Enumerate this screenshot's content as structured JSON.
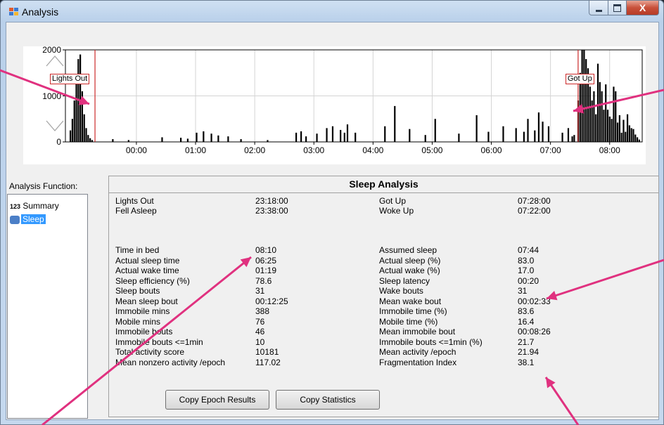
{
  "window": {
    "title": "Analysis",
    "icon": "app-window-icon"
  },
  "titlebar_controls": {
    "minimize": "minimize-icon",
    "maximize": "maximize-icon",
    "close": "close-icon",
    "close_glyph": "X"
  },
  "chart_data": {
    "type": "bar",
    "title": "",
    "xlabel": "",
    "ylabel": "",
    "ylim": [
      0,
      2000
    ],
    "xlim": [
      "22:48",
      "08:33"
    ],
    "y_ticks": [
      "2000",
      "1000",
      "0"
    ],
    "x_ticks": [
      "00:00",
      "01:00",
      "02:00",
      "03:00",
      "04:00",
      "05:00",
      "06:00",
      "07:00",
      "08:00"
    ],
    "grid": true,
    "markers": [
      {
        "label": "Lights Out",
        "time": "23:18",
        "color": "#cc2a2a"
      },
      {
        "label": "Got Up",
        "time": "07:28",
        "color": "#cc2a2a"
      }
    ],
    "series": [
      {
        "x": [
          "22:53",
          "22:55",
          "22:57",
          "22:59",
          "23:01",
          "23:03",
          "23:05",
          "23:07",
          "23:09",
          "23:11",
          "23:13",
          "23:15",
          "23:36",
          "23:52",
          "00:26",
          "00:45",
          "00:52",
          "01:01",
          "01:08",
          "01:16",
          "01:23",
          "01:33",
          "01:46",
          "02:13",
          "02:42",
          "02:47",
          "02:52",
          "03:03",
          "03:13",
          "03:19",
          "03:27",
          "03:31",
          "03:34",
          "03:42",
          "04:12",
          "04:22",
          "04:37",
          "04:53",
          "05:03",
          "05:27",
          "05:45",
          "05:57",
          "06:12",
          "06:25",
          "06:33",
          "06:37",
          "06:44",
          "06:48",
          "06:52",
          "06:58",
          "07:12",
          "07:18",
          "07:22",
          "07:24",
          "07:28",
          "07:30",
          "07:32",
          "07:34",
          "07:36",
          "07:38",
          "07:40",
          "07:42",
          "07:44",
          "07:46",
          "07:48",
          "07:50",
          "07:52",
          "07:54",
          "07:56",
          "07:58",
          "08:00",
          "08:02",
          "08:04",
          "08:06",
          "08:08",
          "08:10",
          "08:12",
          "08:14",
          "08:16",
          "08:18",
          "08:20",
          "08:22",
          "08:24",
          "08:26",
          "08:28",
          "08:30"
        ],
        "values": [
          250,
          500,
          900,
          1400,
          1800,
          1900,
          1100,
          600,
          300,
          150,
          80,
          40,
          60,
          40,
          100,
          90,
          70,
          200,
          230,
          180,
          140,
          120,
          60,
          40,
          200,
          230,
          120,
          180,
          300,
          340,
          260,
          200,
          380,
          200,
          340,
          780,
          280,
          150,
          500,
          180,
          580,
          220,
          340,
          300,
          220,
          500,
          250,
          640,
          440,
          340,
          200,
          300,
          120,
          150,
          900,
          1500,
          2000,
          2000,
          1800,
          1600,
          1200,
          900,
          1100,
          600,
          1700,
          1300,
          1100,
          700,
          1250,
          700,
          550,
          500,
          1200,
          1100,
          420,
          580,
          200,
          480,
          220,
          600,
          360,
          300,
          280,
          160,
          100,
          50
        ]
      }
    ]
  },
  "sidebar": {
    "label": "Analysis Function:",
    "items": [
      {
        "prefix": "123",
        "label": "Summary",
        "icon": "summary-icon"
      },
      {
        "prefix": "",
        "label": "Sleep",
        "icon": "sleep-icon",
        "selected": true
      }
    ]
  },
  "results": {
    "title": "Sleep Analysis",
    "top_left": [
      {
        "label": "Lights Out",
        "value": "23:18:00"
      },
      {
        "label": "Fell Asleep",
        "value": "23:38:00"
      }
    ],
    "top_right": [
      {
        "label": "Got Up",
        "value": "07:28:00"
      },
      {
        "label": "Woke Up",
        "value": "07:22:00"
      }
    ],
    "left": [
      {
        "label": "Time in bed",
        "value": "08:10"
      },
      {
        "label": "Actual sleep time",
        "value": "06:25"
      },
      {
        "label": "Actual wake time",
        "value": "01:19"
      },
      {
        "label": "Sleep efficiency (%)",
        "value": "78.6"
      },
      {
        "label": "Sleep bouts",
        "value": "31"
      },
      {
        "label": "Mean sleep bout",
        "value": "00:12:25"
      },
      {
        "label": "Immobile mins",
        "value": "388"
      },
      {
        "label": "Mobile mins",
        "value": "76"
      },
      {
        "label": "Immobile bouts",
        "value": "46"
      },
      {
        "label": "Immobile bouts <=1min",
        "value": "10"
      },
      {
        "label": "Total activity score",
        "value": "10181"
      },
      {
        "label": "Mean nonzero activity /epoch",
        "value": "117.02"
      }
    ],
    "right": [
      {
        "label": "Assumed sleep",
        "value": "07:44"
      },
      {
        "label": "Actual sleep (%)",
        "value": "83.0"
      },
      {
        "label": "Actual wake (%)",
        "value": "17.0"
      },
      {
        "label": "Sleep latency",
        "value": "00:20"
      },
      {
        "label": "Wake bouts",
        "value": "31"
      },
      {
        "label": "Mean wake bout",
        "value": "00:02:33"
      },
      {
        "label": "Immobile time (%)",
        "value": "83.6"
      },
      {
        "label": "Mobile time (%)",
        "value": "16.4"
      },
      {
        "label": "Mean immobile bout",
        "value": "00:08:26"
      },
      {
        "label": "Immobile bouts <=1min (%)",
        "value": "21.7"
      },
      {
        "label": "Mean activity /epoch",
        "value": "21.94"
      },
      {
        "label": "Fragmentation Index",
        "value": "38.1"
      }
    ],
    "buttons": {
      "copy_epoch": "Copy Epoch Results",
      "copy_stats": "Copy Statistics"
    }
  },
  "annotation_color": "#e0317f",
  "zoom_controls": {
    "up": "zoom-in-triangle-icon",
    "down": "zoom-out-triangle-icon"
  }
}
